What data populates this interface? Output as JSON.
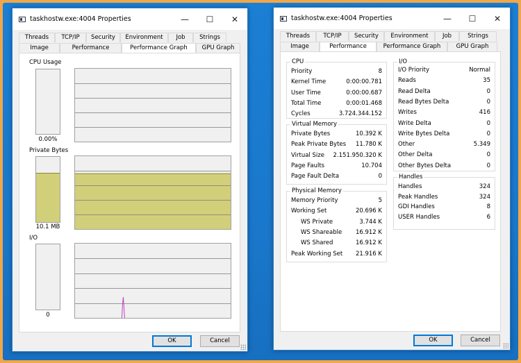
{
  "window1": {
    "title": "taskhostw.exe:4004 Properties",
    "tabs_row1": [
      "Threads",
      "TCP/IP",
      "Security",
      "Environment",
      "Job",
      "Strings"
    ],
    "tabs_row2": [
      "Image",
      "Performance",
      "Performance Graph",
      "GPU Graph"
    ],
    "active_tab": "Performance Graph",
    "cpu": {
      "label": "CPU Usage",
      "value": "0.00%",
      "fill": 0
    },
    "private_bytes": {
      "label": "Private Bytes",
      "value": "10.1 MB",
      "fill": 0.76
    },
    "io": {
      "label": "I/O",
      "value": "0",
      "fill": 0
    },
    "ok_label": "OK",
    "cancel_label": "Cancel"
  },
  "window2": {
    "title": "taskhostw.exe:4004 Properties",
    "tabs_row1": [
      "Threads",
      "TCP/IP",
      "Security",
      "Environment",
      "Job",
      "Strings"
    ],
    "tabs_row2": [
      "Image",
      "Performance",
      "Performance Graph",
      "GPU Graph"
    ],
    "active_tab": "Performance",
    "cpu": {
      "title": "CPU",
      "rows": [
        [
          "Priority",
          "8"
        ],
        [
          "Kernel Time",
          "0:00:00.781"
        ],
        [
          "User Time",
          "0:00:00.687"
        ],
        [
          "Total Time",
          "0:00:01.468"
        ],
        [
          "Cycles",
          "3.724.344.152"
        ]
      ]
    },
    "virtual_memory": {
      "title": "Virtual Memory",
      "rows": [
        [
          "Private Bytes",
          "10.392 K"
        ],
        [
          "Peak Private Bytes",
          "11.780 K"
        ],
        [
          "Virtual Size",
          "2.151.950.320 K"
        ],
        [
          "Page Faults",
          "10.704"
        ],
        [
          "Page Fault Delta",
          "0"
        ]
      ]
    },
    "physical_memory": {
      "title": "Physical Memory",
      "rows": [
        [
          "Memory Priority",
          "5"
        ],
        [
          "Working Set",
          "20.696 K"
        ],
        [
          "WS Private",
          "3.744 K"
        ],
        [
          "WS Shareable",
          "16.912 K"
        ],
        [
          "WS Shared",
          "16.912 K"
        ],
        [
          "Peak Working Set",
          "21.916 K"
        ]
      ]
    },
    "io": {
      "title": "I/O",
      "rows": [
        [
          "I/O Priority",
          "Normal"
        ],
        [
          "Reads",
          "35"
        ],
        [
          "Read Delta",
          "0"
        ],
        [
          "Read Bytes Delta",
          "0"
        ],
        [
          "Writes",
          "416"
        ],
        [
          "Write Delta",
          "0"
        ],
        [
          "Write Bytes Delta",
          "0"
        ],
        [
          "Other",
          "5.349"
        ],
        [
          "Other Delta",
          "0"
        ],
        [
          "Other Bytes Delta",
          "0"
        ]
      ]
    },
    "handles": {
      "title": "Handles",
      "rows": [
        [
          "Handles",
          "324"
        ],
        [
          "Peak Handles",
          "324"
        ],
        [
          "GDI Handles",
          "8"
        ],
        [
          "USER Handles",
          "6"
        ]
      ]
    },
    "ok_label": "OK",
    "cancel_label": "Cancel"
  },
  "caption": {
    "minimize": "—",
    "maximize": "☐",
    "close": "✕"
  },
  "colors": {
    "accent": "#0078d7",
    "graph_fill": "#d2cf7a",
    "io_spike": "#c040c0",
    "desktop": "#1a78cc",
    "frame": "#f1a64a"
  }
}
